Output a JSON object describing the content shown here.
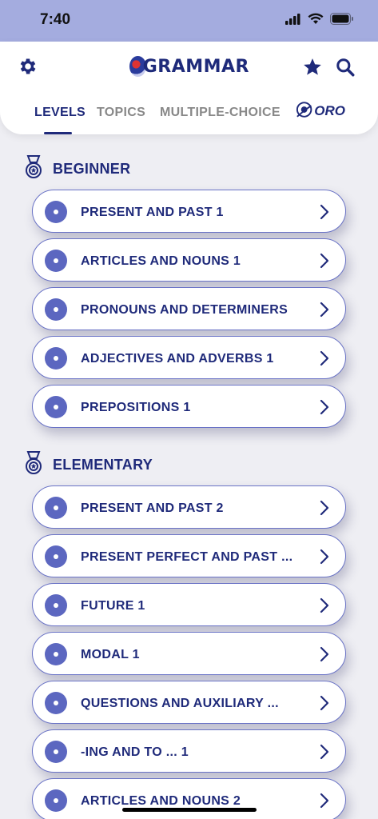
{
  "status_bar": {
    "time": "7:40"
  },
  "header": {
    "logo_text": "GRAMMAR",
    "tabs": [
      {
        "label": "LEVELS",
        "active": true
      },
      {
        "label": "TOPICS",
        "active": false
      },
      {
        "label": "MULTIPLE-CHOICE",
        "active": false
      }
    ],
    "partner_logo_text": "ORO"
  },
  "sections": [
    {
      "title": "BEGINNER",
      "lessons": [
        "PRESENT AND PAST 1",
        "ARTICLES AND NOUNS 1",
        "PRONOUNS AND DETERMINERS",
        "ADJECTIVES AND ADVERBS 1",
        "PREPOSITIONS 1"
      ]
    },
    {
      "title": "ELEMENTARY",
      "lessons": [
        "PRESENT AND PAST 2",
        "PRESENT PERFECT AND PAST ...",
        "FUTURE 1",
        "MODAL 1",
        "QUESTIONS AND AUXILIARY ...",
        "-ING AND TO ... 1",
        "ARTICLES AND NOUNS 2"
      ]
    }
  ],
  "colors": {
    "accent": "#1f2a7a",
    "status_bar": "#a4acdf",
    "dot": "#5c67c0"
  }
}
